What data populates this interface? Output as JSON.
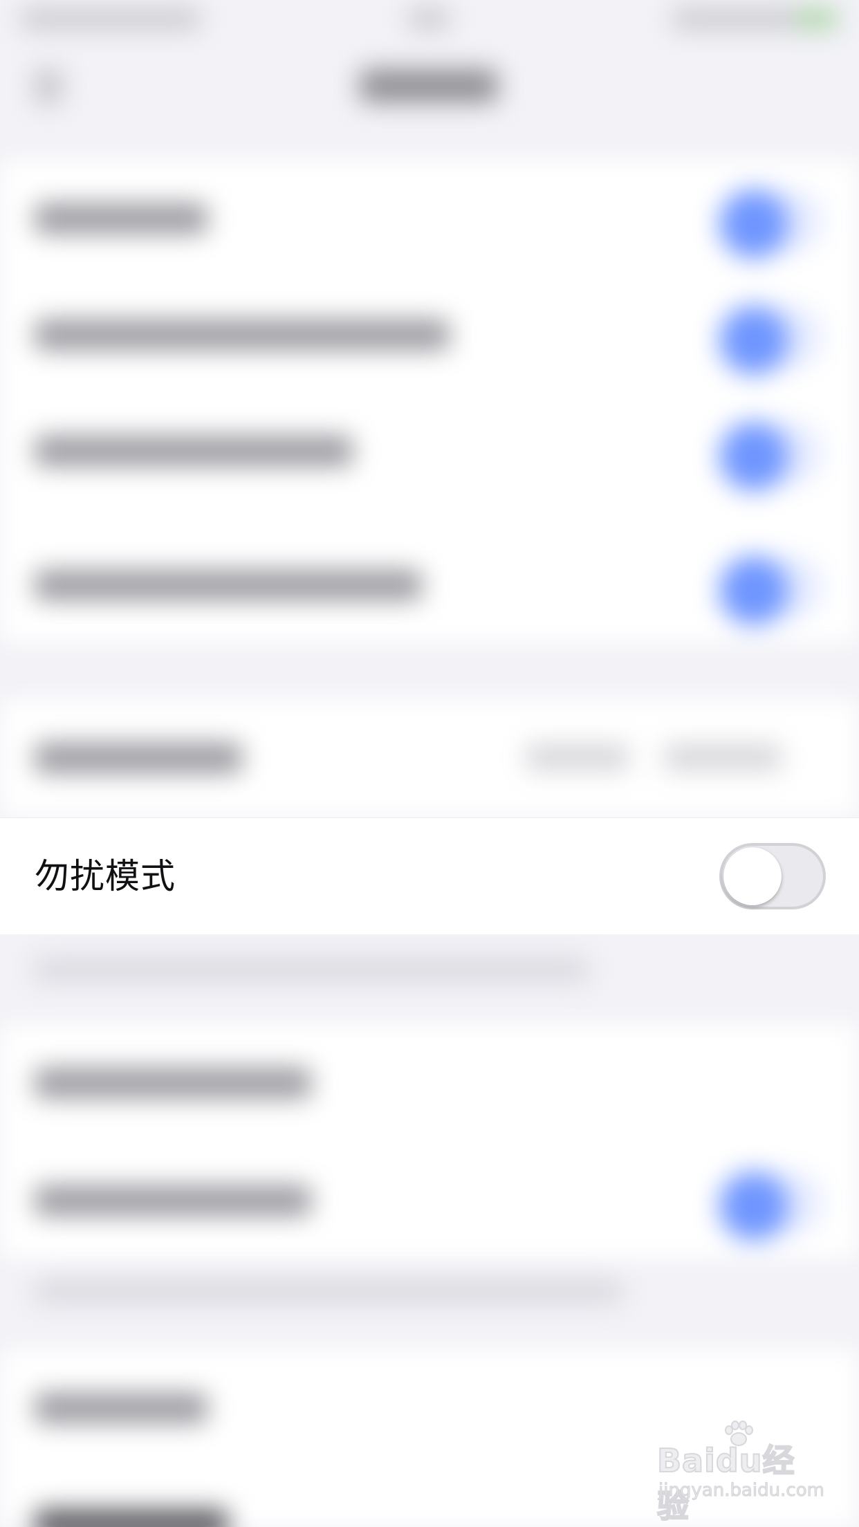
{
  "dnd": {
    "label": "勿扰模式",
    "enabled": false
  },
  "watermark": {
    "brand": "Baidu经验",
    "url": "jingyan.baidu.com"
  },
  "colors": {
    "background": "#f2f2f7",
    "row_bg": "#ffffff",
    "blurred_toggle_accent": "#6f96ff",
    "switch_off_track": "#e9e9ee",
    "label_text": "#111114"
  },
  "icons": {
    "back": "chevron-left-icon",
    "watermark_paw": "paw-icon"
  }
}
